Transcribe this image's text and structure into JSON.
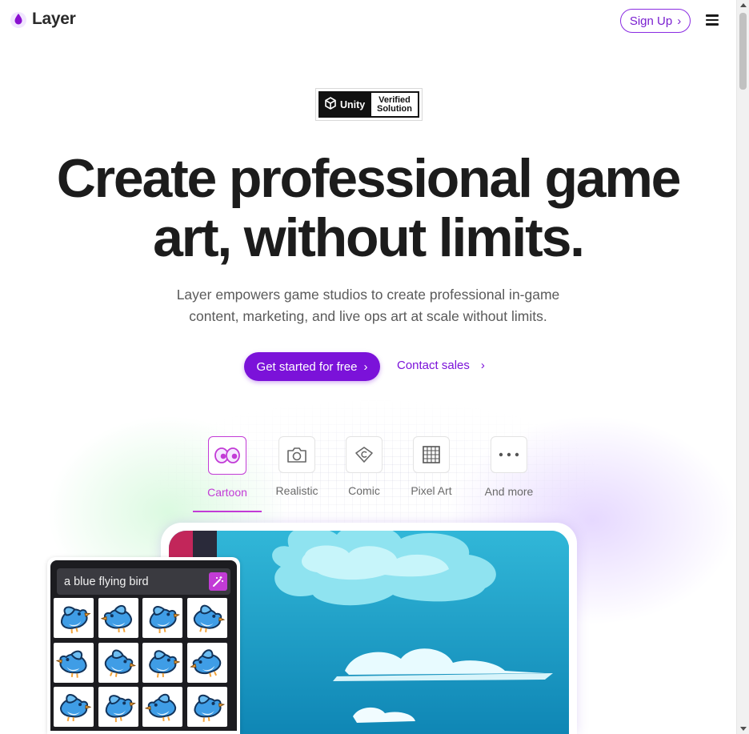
{
  "header": {
    "brand": "Layer",
    "signup_label": "Sign Up",
    "signup_chevron": "›"
  },
  "badge": {
    "unity": "Unity",
    "line1": "Verified",
    "line2": "Solution"
  },
  "hero": {
    "title_line1": "Create professional game",
    "title_line2": "art, without limits.",
    "subtitle_line1": "Layer empowers game studios to create professional in-game",
    "subtitle_line2": "content, marketing, and live ops art at scale without limits.",
    "cta_primary": "Get started for free",
    "cta_primary_chevron": "›",
    "cta_secondary": "Contact sales",
    "cta_secondary_chevron": "›"
  },
  "styles": {
    "items": [
      {
        "label": "Cartoon",
        "icon": "cartoon-eyes-icon",
        "active": true
      },
      {
        "label": "Realistic",
        "icon": "camera-icon",
        "active": false
      },
      {
        "label": "Comic",
        "icon": "comic-badge-icon",
        "active": false
      },
      {
        "label": "Pixel Art",
        "icon": "pixel-grid-icon",
        "active": false
      },
      {
        "label": "And more",
        "icon": "more-dots-icon",
        "active": false
      }
    ]
  },
  "generator": {
    "prompt": "a blue flying bird",
    "result_count": 12
  },
  "colors": {
    "accent": "#7b12d9",
    "active_tab": "#c23bd6",
    "sky": "#1aa3c9"
  }
}
